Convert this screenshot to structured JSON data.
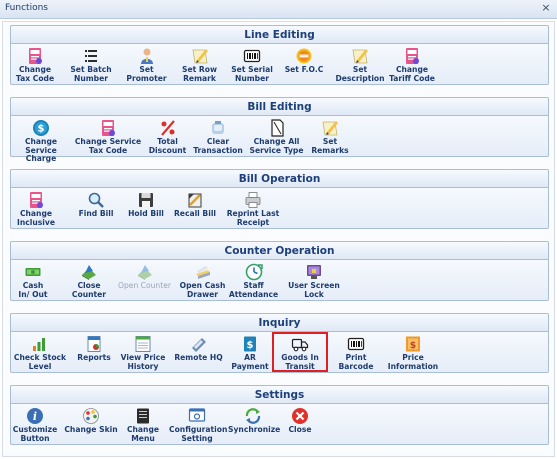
{
  "window": {
    "title": "Functions",
    "close_glyph": "×"
  },
  "sections": [
    {
      "title": "Line Editing",
      "buttons": [
        {
          "label": "Change\nTax Code",
          "icon": "tax-doc-icon"
        },
        {
          "label": "Set Batch\nNumber",
          "icon": "batch-list-icon"
        },
        {
          "label": "Set Promoter",
          "icon": "promoter-person-icon"
        },
        {
          "label": "Set Row\nRemark",
          "icon": "note-pencil-icon"
        },
        {
          "label": "Set Serial\nNumber",
          "icon": "barcode-icon"
        },
        {
          "label": "Set F.O.C",
          "icon": "free-badge-icon"
        },
        {
          "label": "Set\nDescription",
          "icon": "note-pencil-icon"
        },
        {
          "label": "Change\nTariff Code",
          "icon": "tax-doc-icon"
        }
      ]
    },
    {
      "title": "Bill Editing",
      "buttons": [
        {
          "label": "Change Service\nCharge",
          "icon": "dollar-coin-icon"
        },
        {
          "label": "Change Service\nTax Code",
          "icon": "tax-doc-icon"
        },
        {
          "label": "Total\nDiscount",
          "icon": "percent-icon"
        },
        {
          "label": "Clear\nTransaction",
          "icon": "eraser-icon"
        },
        {
          "label": "Change All\nService Type",
          "icon": "document-icon"
        },
        {
          "label": "Set\nRemarks",
          "icon": "note-pencil-icon"
        }
      ]
    },
    {
      "title": "Bill Operation",
      "buttons": [
        {
          "label": "Change\nInclusive",
          "icon": "tax-doc-icon"
        },
        {
          "label": "Find Bill",
          "icon": "magnifier-icon"
        },
        {
          "label": "Hold Bill",
          "icon": "floppy-disk-icon"
        },
        {
          "label": "Recall Bill",
          "icon": "recall-icon"
        },
        {
          "label": "Reprint Last\nReceipt",
          "icon": "printer-icon"
        }
      ]
    },
    {
      "title": "Counter Operation",
      "buttons": [
        {
          "label": "Cash\nIn/ Out",
          "icon": "cash-icon"
        },
        {
          "label": "Close\nCounter",
          "icon": "counter-icon"
        },
        {
          "label": "Open Counter",
          "icon": "counter-icon",
          "disabled": true
        },
        {
          "label": "Open Cash\nDrawer",
          "icon": "cash-drawer-icon"
        },
        {
          "label": "Staff\nAttendance",
          "icon": "clock-icon"
        },
        {
          "label": "User Screen\nLock",
          "icon": "screen-lock-icon"
        }
      ]
    },
    {
      "title": "Inquiry",
      "buttons": [
        {
          "label": "Check Stock\nLevel",
          "icon": "bar-chart-icon"
        },
        {
          "label": "Reports",
          "icon": "report-icon"
        },
        {
          "label": "View Price\nHistory",
          "icon": "price-history-icon"
        },
        {
          "label": "Remote HQ",
          "icon": "remote-icon"
        },
        {
          "label": "AR\nPayment",
          "icon": "dollar-doc-icon"
        },
        {
          "label": "Goods In\nTransit",
          "icon": "truck-icon",
          "selected": true
        },
        {
          "label": "Print\nBarcode",
          "icon": "barcode-icon"
        },
        {
          "label": "Price\nInformation",
          "icon": "price-info-icon"
        }
      ]
    },
    {
      "title": "Settings",
      "buttons": [
        {
          "label": "Customize\nButton",
          "icon": "info-icon"
        },
        {
          "label": "Change Skin",
          "icon": "palette-icon"
        },
        {
          "label": "Change\nMenu",
          "icon": "menu-icon"
        },
        {
          "label": "Configuration\nSetting",
          "icon": "configuration-icon"
        },
        {
          "label": "Synchronize",
          "icon": "sync-icon"
        },
        {
          "label": "Close",
          "icon": "close-circle-icon"
        }
      ]
    }
  ]
}
